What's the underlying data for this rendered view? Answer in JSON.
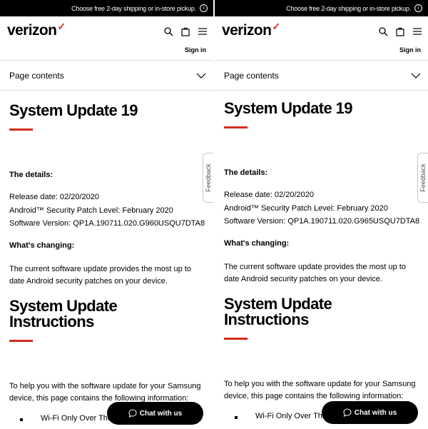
{
  "topbar": {
    "text": "Choose free 2-day shipping or in-store pickup.",
    "info_icon": "info-icon"
  },
  "header": {
    "brand": "verizon",
    "check": "✓",
    "signin": "Sign in"
  },
  "page_contents": {
    "label": "Page contents"
  },
  "article": {
    "title": "System Update 19",
    "details_heading": "The details:",
    "release_date": "Release date: 02/20/2020",
    "patch_level": "Android™ Security Patch Level: February 2020",
    "changing_heading": "What's changing:",
    "changing_text_1": "The current software update provides the most up to",
    "changing_text_2": "date Android security patches on your device.",
    "instructions_line1": "System Update",
    "instructions_line2": "Instructions",
    "help_line1": "To help you with the software update for your Samsung",
    "help_line2": "device, this page contains the following information:",
    "bullet_1": "Wi-Fi Only Over The"
  },
  "left": {
    "software_version": "Software Version: QP1A.190711.020.G960USQU7DTA8"
  },
  "right": {
    "software_version": "Software Version: QP1A.190711.020.G965USQU7DTA8"
  },
  "feedback": {
    "label": "Feedback"
  },
  "chat": {
    "label": "Chat with us"
  },
  "colors": {
    "brand_red": "#d52b1e",
    "black": "#000000"
  }
}
